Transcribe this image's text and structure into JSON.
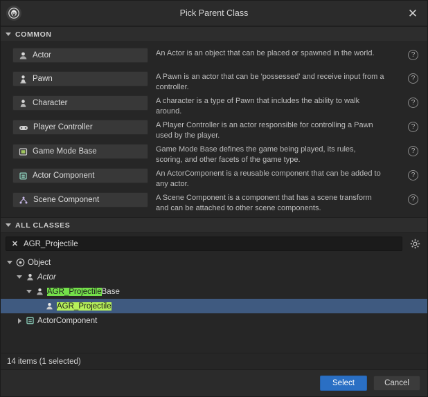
{
  "window": {
    "title": "Pick Parent Class",
    "logo_icon": "unreal-engine-logo",
    "close_icon": "close-icon"
  },
  "sections": {
    "common": {
      "label": "COMMON",
      "expanded": true
    },
    "all_classes": {
      "label": "ALL CLASSES",
      "expanded": true
    }
  },
  "common_classes": [
    {
      "label": "Actor",
      "icon": "actor-icon",
      "description": "An Actor is an object that can be placed or spawned in the world.",
      "help_icon": "help-icon"
    },
    {
      "label": "Pawn",
      "icon": "pawn-icon",
      "description": "A Pawn is an actor that can be 'possessed' and receive input from a controller.",
      "help_icon": "help-icon"
    },
    {
      "label": "Character",
      "icon": "character-icon",
      "description": "A character is a type of Pawn that includes the ability to walk around.",
      "help_icon": "help-icon"
    },
    {
      "label": "Player Controller",
      "icon": "player-controller-icon",
      "description": "A Player Controller is an actor responsible for controlling a Pawn used by the player.",
      "help_icon": "help-icon"
    },
    {
      "label": "Game Mode Base",
      "icon": "game-mode-base-icon",
      "description": "Game Mode Base defines the game being played, its rules, scoring, and other facets of the game type.",
      "help_icon": "help-icon"
    },
    {
      "label": "Actor Component",
      "icon": "actor-component-icon",
      "description": "An ActorComponent is a reusable component that can be added to any actor.",
      "help_icon": "help-icon"
    },
    {
      "label": "Scene Component",
      "icon": "scene-component-icon",
      "description": "A Scene Component is a component that has a scene transform and can be attached to other scene components.",
      "help_icon": "help-icon"
    }
  ],
  "search": {
    "value": "AGR_Projectile",
    "placeholder": "Search Classes",
    "clear_icon": "clear-x-icon",
    "settings_icon": "gear-icon"
  },
  "tree": [
    {
      "depth": 0,
      "label": "Object",
      "icon": "object-icon",
      "expanded": true,
      "has_children": true,
      "italic": false,
      "selected": false,
      "highlight": ""
    },
    {
      "depth": 1,
      "label": "Actor",
      "icon": "actor-icon",
      "expanded": true,
      "has_children": true,
      "italic": true,
      "selected": false,
      "highlight": ""
    },
    {
      "depth": 2,
      "label": "AGR_ProjectileBase",
      "icon": "actor-icon",
      "expanded": true,
      "has_children": true,
      "italic": false,
      "selected": false,
      "highlight": "AGR_Projectile"
    },
    {
      "depth": 3,
      "label": "AGR_Projectile",
      "icon": "actor-icon",
      "expanded": false,
      "has_children": false,
      "italic": false,
      "selected": true,
      "highlight": "AGR_Projectile"
    },
    {
      "depth": 1,
      "label": "ActorComponent",
      "icon": "actor-component-icon",
      "expanded": false,
      "has_children": true,
      "italic": false,
      "selected": false,
      "highlight": ""
    }
  ],
  "status": {
    "text": "14 items (1 selected)"
  },
  "footer": {
    "select_label": "Select",
    "cancel_label": "Cancel"
  },
  "colors": {
    "accent": "#2a6fc4",
    "selection": "#3f5a80",
    "highlight": "#74e04a",
    "highlight_selected": "#b6f05a"
  }
}
